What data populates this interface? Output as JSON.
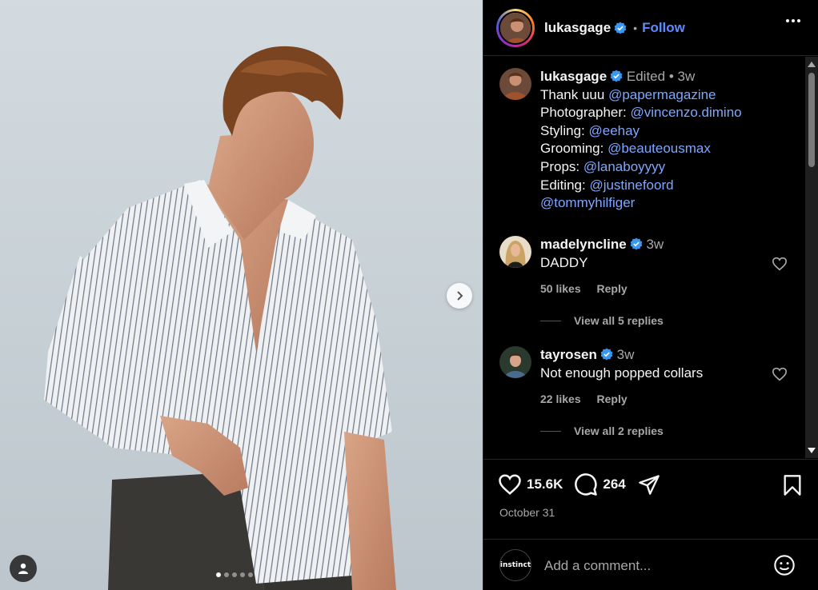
{
  "post": {
    "carousel": {
      "total_slides": 5,
      "active_slide": 1
    },
    "next_icon": "chevron-right-icon",
    "user_tag_icon": "person-icon"
  },
  "header": {
    "username": "lukasgage",
    "separator": "•",
    "follow_label": "Follow",
    "verified_icon": "verified-badge-icon",
    "more_icon": "more-options-icon"
  },
  "caption": {
    "username": "lukasgage",
    "edited": "Edited",
    "dot": "•",
    "age": "3w",
    "lines": [
      {
        "prefix": "Thank uuu ",
        "mention": "@papermagazine"
      },
      {
        "prefix": "Photographer: ",
        "mention": "@vincenzo.dimino"
      },
      {
        "prefix": "Styling: ",
        "mention": "@eehay"
      },
      {
        "prefix": "Grooming: ",
        "mention": "@beauteousmax"
      },
      {
        "prefix": "Props: ",
        "mention": "@lanaboyyyy"
      },
      {
        "prefix": "Editing: ",
        "mention": "@justinefoord"
      },
      {
        "prefix": "",
        "mention": "@tommyhilfiger"
      }
    ]
  },
  "comments": [
    {
      "username": "madelyncline",
      "age": "3w",
      "text": "DADDY",
      "likes": "50 likes",
      "reply": "Reply",
      "view_replies": "View all 5 replies"
    },
    {
      "username": "tayrosen",
      "age": "3w",
      "text": "Not enough popped collars",
      "likes": "22 likes",
      "reply": "Reply",
      "view_replies": "View all 2 replies"
    }
  ],
  "actions": {
    "like_count": "15.6K",
    "comment_count": "264",
    "date": "October 31",
    "icons": [
      "heart-icon",
      "comment-icon",
      "share-icon",
      "bookmark-icon"
    ]
  },
  "add_comment": {
    "avatar_text": "instinct",
    "placeholder": "Add a comment...",
    "emoji_icon": "emoji-icon"
  },
  "colors": {
    "link": "#7ea7ff",
    "follow": "#5b8cff",
    "verified": "#3897f0",
    "background": "#000000"
  }
}
